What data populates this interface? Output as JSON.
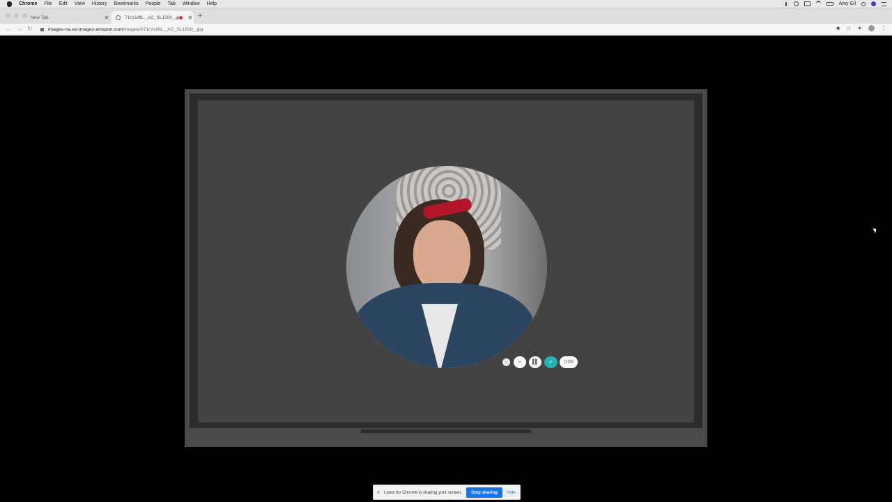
{
  "menubar": {
    "app_name": "Chrome",
    "menus": [
      "File",
      "Edit",
      "View",
      "History",
      "Bookmarks",
      "People",
      "Tab",
      "Window",
      "Help"
    ],
    "user_name": "Amy Gil"
  },
  "tabs": [
    {
      "title": "New Tab",
      "active": false
    },
    {
      "title": "71rVsiIftL._AC_SL1500_.jp",
      "active": true,
      "recording": true
    }
  ],
  "toolbar": {
    "url_host": "images-na.ssl-images-amazon.com",
    "url_path": "/images/I/71rVsiIftL._AC_SL1500_.jpg"
  },
  "loom": {
    "timer": "0:00",
    "accent_color": "#22b5b5"
  },
  "share_banner": {
    "message": "Loom for Chrome is sharing your screen.",
    "stop_label": "Stop sharing",
    "hide_label": "Hide"
  }
}
